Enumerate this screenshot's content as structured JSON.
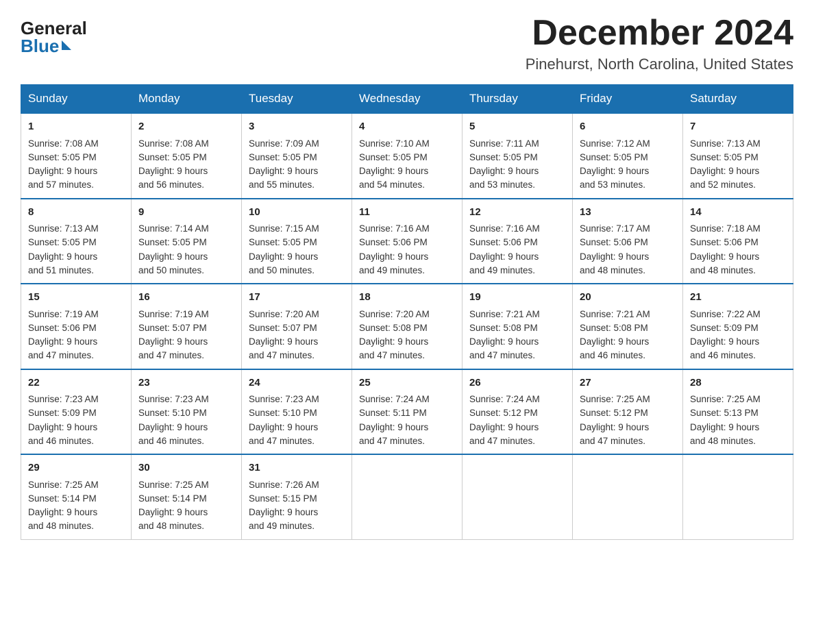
{
  "logo": {
    "general": "General",
    "blue": "Blue"
  },
  "title": {
    "month": "December 2024",
    "location": "Pinehurst, North Carolina, United States"
  },
  "headers": [
    "Sunday",
    "Monday",
    "Tuesday",
    "Wednesday",
    "Thursday",
    "Friday",
    "Saturday"
  ],
  "weeks": [
    [
      {
        "day": "1",
        "sunrise": "7:08 AM",
        "sunset": "5:05 PM",
        "daylight": "9 hours and 57 minutes."
      },
      {
        "day": "2",
        "sunrise": "7:08 AM",
        "sunset": "5:05 PM",
        "daylight": "9 hours and 56 minutes."
      },
      {
        "day": "3",
        "sunrise": "7:09 AM",
        "sunset": "5:05 PM",
        "daylight": "9 hours and 55 minutes."
      },
      {
        "day": "4",
        "sunrise": "7:10 AM",
        "sunset": "5:05 PM",
        "daylight": "9 hours and 54 minutes."
      },
      {
        "day": "5",
        "sunrise": "7:11 AM",
        "sunset": "5:05 PM",
        "daylight": "9 hours and 53 minutes."
      },
      {
        "day": "6",
        "sunrise": "7:12 AM",
        "sunset": "5:05 PM",
        "daylight": "9 hours and 53 minutes."
      },
      {
        "day": "7",
        "sunrise": "7:13 AM",
        "sunset": "5:05 PM",
        "daylight": "9 hours and 52 minutes."
      }
    ],
    [
      {
        "day": "8",
        "sunrise": "7:13 AM",
        "sunset": "5:05 PM",
        "daylight": "9 hours and 51 minutes."
      },
      {
        "day": "9",
        "sunrise": "7:14 AM",
        "sunset": "5:05 PM",
        "daylight": "9 hours and 50 minutes."
      },
      {
        "day": "10",
        "sunrise": "7:15 AM",
        "sunset": "5:05 PM",
        "daylight": "9 hours and 50 minutes."
      },
      {
        "day": "11",
        "sunrise": "7:16 AM",
        "sunset": "5:06 PM",
        "daylight": "9 hours and 49 minutes."
      },
      {
        "day": "12",
        "sunrise": "7:16 AM",
        "sunset": "5:06 PM",
        "daylight": "9 hours and 49 minutes."
      },
      {
        "day": "13",
        "sunrise": "7:17 AM",
        "sunset": "5:06 PM",
        "daylight": "9 hours and 48 minutes."
      },
      {
        "day": "14",
        "sunrise": "7:18 AM",
        "sunset": "5:06 PM",
        "daylight": "9 hours and 48 minutes."
      }
    ],
    [
      {
        "day": "15",
        "sunrise": "7:19 AM",
        "sunset": "5:06 PM",
        "daylight": "9 hours and 47 minutes."
      },
      {
        "day": "16",
        "sunrise": "7:19 AM",
        "sunset": "5:07 PM",
        "daylight": "9 hours and 47 minutes."
      },
      {
        "day": "17",
        "sunrise": "7:20 AM",
        "sunset": "5:07 PM",
        "daylight": "9 hours and 47 minutes."
      },
      {
        "day": "18",
        "sunrise": "7:20 AM",
        "sunset": "5:08 PM",
        "daylight": "9 hours and 47 minutes."
      },
      {
        "day": "19",
        "sunrise": "7:21 AM",
        "sunset": "5:08 PM",
        "daylight": "9 hours and 47 minutes."
      },
      {
        "day": "20",
        "sunrise": "7:21 AM",
        "sunset": "5:08 PM",
        "daylight": "9 hours and 46 minutes."
      },
      {
        "day": "21",
        "sunrise": "7:22 AM",
        "sunset": "5:09 PM",
        "daylight": "9 hours and 46 minutes."
      }
    ],
    [
      {
        "day": "22",
        "sunrise": "7:23 AM",
        "sunset": "5:09 PM",
        "daylight": "9 hours and 46 minutes."
      },
      {
        "day": "23",
        "sunrise": "7:23 AM",
        "sunset": "5:10 PM",
        "daylight": "9 hours and 46 minutes."
      },
      {
        "day": "24",
        "sunrise": "7:23 AM",
        "sunset": "5:10 PM",
        "daylight": "9 hours and 47 minutes."
      },
      {
        "day": "25",
        "sunrise": "7:24 AM",
        "sunset": "5:11 PM",
        "daylight": "9 hours and 47 minutes."
      },
      {
        "day": "26",
        "sunrise": "7:24 AM",
        "sunset": "5:12 PM",
        "daylight": "9 hours and 47 minutes."
      },
      {
        "day": "27",
        "sunrise": "7:25 AM",
        "sunset": "5:12 PM",
        "daylight": "9 hours and 47 minutes."
      },
      {
        "day": "28",
        "sunrise": "7:25 AM",
        "sunset": "5:13 PM",
        "daylight": "9 hours and 48 minutes."
      }
    ],
    [
      {
        "day": "29",
        "sunrise": "7:25 AM",
        "sunset": "5:14 PM",
        "daylight": "9 hours and 48 minutes."
      },
      {
        "day": "30",
        "sunrise": "7:25 AM",
        "sunset": "5:14 PM",
        "daylight": "9 hours and 48 minutes."
      },
      {
        "day": "31",
        "sunrise": "7:26 AM",
        "sunset": "5:15 PM",
        "daylight": "9 hours and 49 minutes."
      },
      null,
      null,
      null,
      null
    ]
  ]
}
